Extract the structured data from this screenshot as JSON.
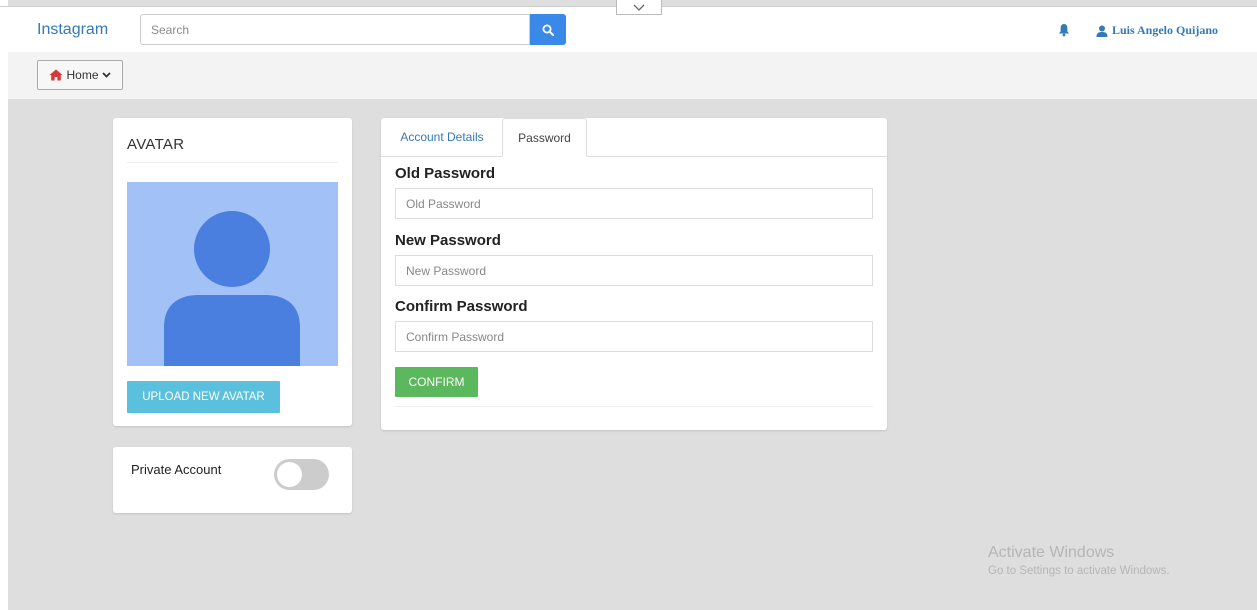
{
  "navbar": {
    "brand": "Instagram",
    "search_placeholder": "Search",
    "user_name": "Luis Angelo Quijano"
  },
  "subbar": {
    "home_label": "Home"
  },
  "avatar_card": {
    "title": "AVATAR",
    "upload_label": "UPLOAD NEW AVATAR"
  },
  "private_card": {
    "label": "Private Account",
    "enabled": false
  },
  "tabs": [
    {
      "label": "Account Details",
      "active": false
    },
    {
      "label": "Password",
      "active": true
    }
  ],
  "password_form": {
    "old_label": "Old Password",
    "old_placeholder": "Old Password",
    "new_label": "New Password",
    "new_placeholder": "New Password",
    "confirm_label": "Confirm Password",
    "confirm_placeholder": "Confirm Password",
    "submit_label": "CONFIRM"
  },
  "watermark": {
    "title": "Activate Windows",
    "subtitle": "Go to Settings to activate Windows."
  },
  "colors": {
    "brand_blue": "#337ab7",
    "search_button": "#3a88e8",
    "upload_button": "#5bc0de",
    "confirm_button": "#5cb85c",
    "avatar_bg": "#a2c1f7",
    "avatar_figure": "#4a7fe0"
  },
  "icons": {
    "search": "search-icon",
    "bell": "bell-icon",
    "user": "user-icon",
    "home": "home-icon",
    "chevron": "chevron-down-icon"
  }
}
